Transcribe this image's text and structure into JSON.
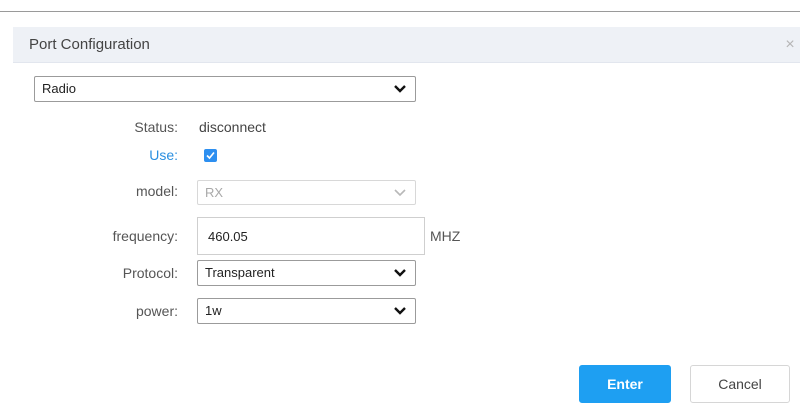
{
  "dialog": {
    "title": "Port Configuration",
    "close_glyph": "×"
  },
  "port_type": {
    "selected": "Radio"
  },
  "fields": {
    "status": {
      "label": "Status:",
      "value": "disconnect"
    },
    "use": {
      "label": "Use:",
      "checked": true
    },
    "model": {
      "label": "model:",
      "selected": "RX",
      "disabled": true
    },
    "frequency": {
      "label": "frequency:",
      "value": "460.05",
      "unit": "MHZ"
    },
    "protocol": {
      "label": "Protocol:",
      "selected": "Transparent"
    },
    "power": {
      "label": "power:",
      "selected": "1w"
    }
  },
  "buttons": {
    "enter": "Enter",
    "cancel": "Cancel"
  },
  "colors": {
    "primary": "#1e9ff2",
    "checkbox": "#2d8ff0",
    "label_highlight": "#2a8fe0",
    "header_bg": "#eef1f6"
  }
}
